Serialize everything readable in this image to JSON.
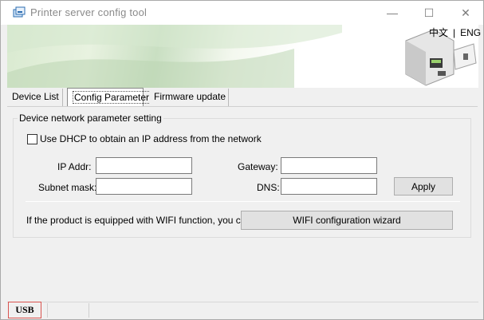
{
  "window": {
    "title": "Printer server config tool",
    "controls": {
      "minimize": "—",
      "maximize": "☐",
      "close": "✕"
    }
  },
  "banner": {
    "lang_cn": "中文",
    "lang_sep": "|",
    "lang_en": "ENG"
  },
  "tabs": [
    {
      "label": "Device List"
    },
    {
      "label": "Config Parameter"
    },
    {
      "label": "Firmware update"
    }
  ],
  "config": {
    "group_title": "Device network parameter setting",
    "dhcp_label": "Use DHCP to obtain an IP address from the network",
    "dhcp_checked": false,
    "ip_label": "IP Addr:",
    "ip_value": "",
    "gateway_label": "Gateway:",
    "gateway_value": "",
    "subnet_label": "Subnet mask:",
    "subnet_value": "",
    "dns_label": "DNS:",
    "dns_value": "",
    "apply_label": "Apply",
    "wifi_text": "If the product is equipped with WIFI function, you can",
    "wifi_button": "WIFI configuration wizard"
  },
  "statusbar": {
    "connection": "USB"
  },
  "colors": {
    "status_border": "#d9534f",
    "button_bg": "#e1e1e1",
    "window_bg": "#f0f0f0"
  }
}
